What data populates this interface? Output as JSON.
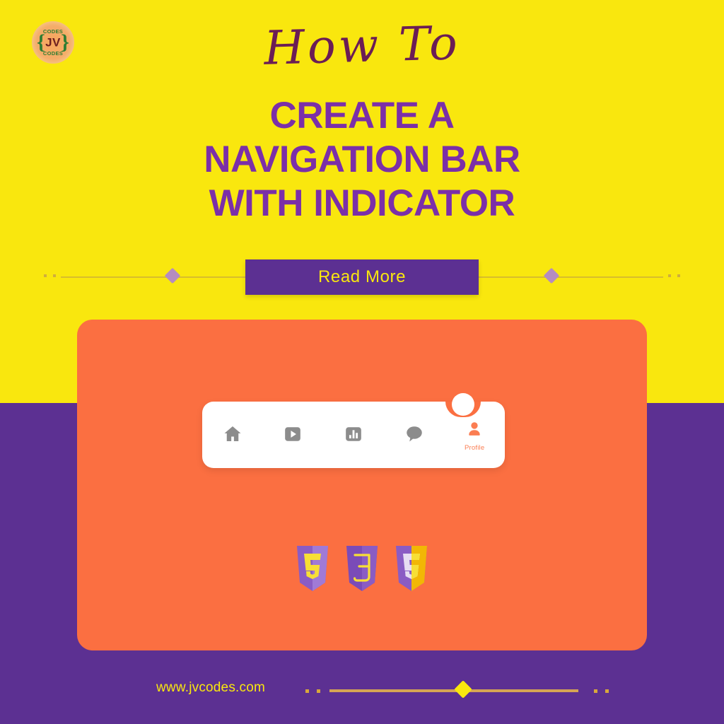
{
  "colors": {
    "yellow_bg": "#f9e70e",
    "purple_bg": "#5c3092",
    "orange_card": "#fb6f41",
    "heading_purple": "#7b2fa8",
    "script_maroon": "#6b1d55",
    "nav_card_white": "#ffffff",
    "nav_icon_gray": "#8c8c8c",
    "nav_active_orange": "#fb7d52",
    "gold_line": "#d6a554"
  },
  "logo": {
    "name": "jvcodes-logo",
    "initials": "JV",
    "top_text": "CODES",
    "bottom_text": "CODES",
    "brace_left": "{",
    "brace_right": "}"
  },
  "header": {
    "script_title": "How To",
    "heading_lines": [
      "CREATE A",
      "NAVIGATION BAR",
      "WITH INDICATOR"
    ]
  },
  "cta": {
    "read_more_label": "Read More"
  },
  "navbar": {
    "items": [
      {
        "icon": "home-icon",
        "label": "",
        "active": false
      },
      {
        "icon": "video-icon",
        "label": "",
        "active": false
      },
      {
        "icon": "stats-icon",
        "label": "",
        "active": false
      },
      {
        "icon": "chat-icon",
        "label": "",
        "active": false
      },
      {
        "icon": "profile-icon",
        "label": "Profile",
        "active": true
      }
    ],
    "indicator_name": "active-indicator"
  },
  "tech_logos": [
    {
      "name": "html5-shield",
      "glyph": "5"
    },
    {
      "name": "css3-shield",
      "glyph": "3"
    },
    {
      "name": "js-shield",
      "glyph": "5"
    }
  ],
  "footer": {
    "url": "www.jvcodes.com"
  }
}
